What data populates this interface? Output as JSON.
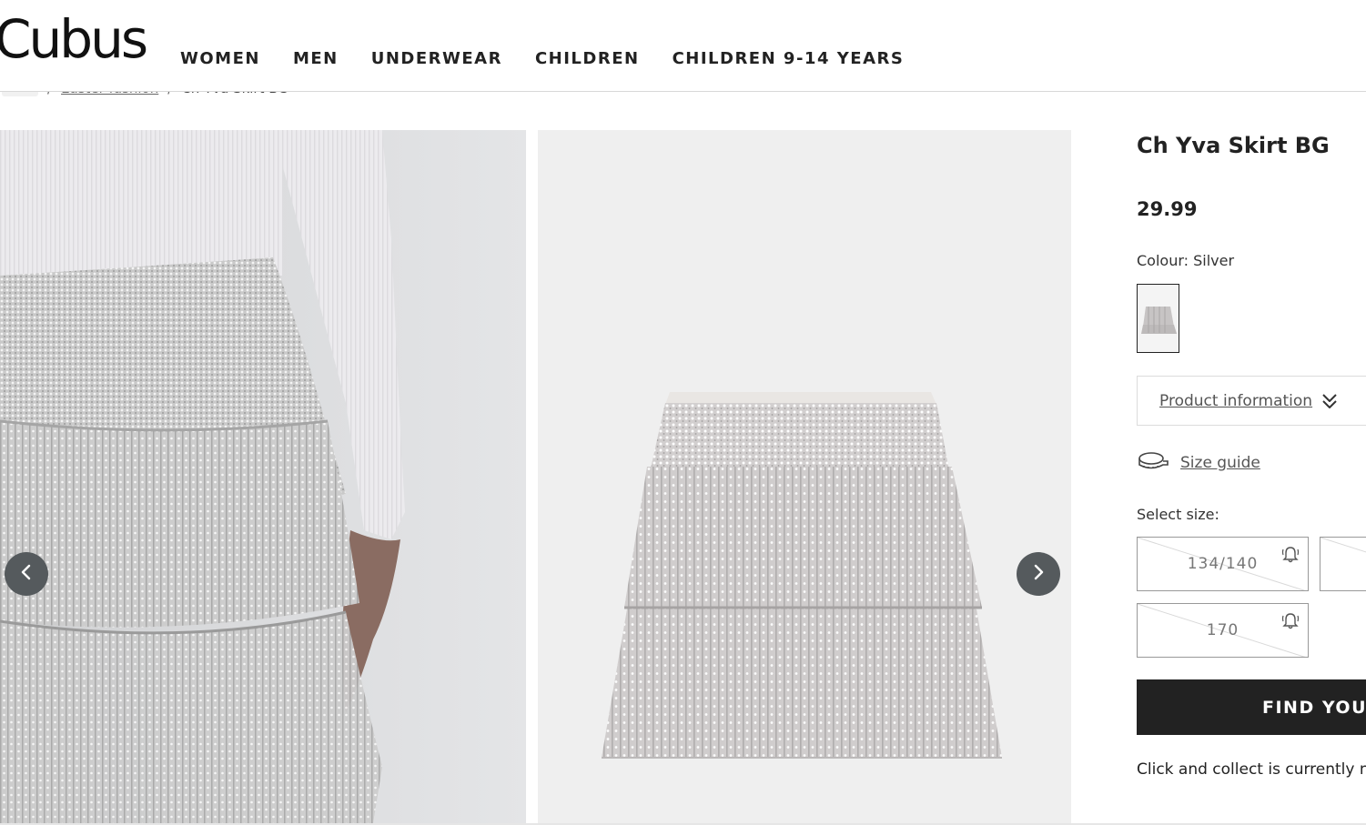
{
  "header": {
    "logo": "Cubus",
    "nav": [
      "WOMEN",
      "MEN",
      "UNDERWEAR",
      "CHILDREN",
      "CHILDREN 9-14 YEARS"
    ]
  },
  "breadcrumb": {
    "parent": "Easter fashion",
    "current": "Ch Yva Skirt BG"
  },
  "product": {
    "title": "Ch Yva Skirt BG",
    "price": "29.99",
    "colour_label": "Colour: Silver",
    "product_info_label": "Product information",
    "size_guide_label": "Size guide",
    "select_size_label": "Select size:",
    "sizes": [
      "134/140",
      "170"
    ],
    "find_button": "FIND YOUR",
    "collect_text": "Click and collect is currently n"
  },
  "colors": {
    "primary": "#222222",
    "arrow_bg": "#555a5d",
    "border": "#dcdcdc"
  }
}
